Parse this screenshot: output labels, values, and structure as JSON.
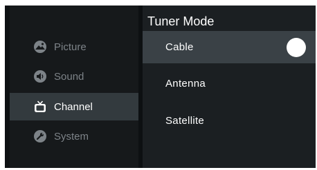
{
  "menu": {
    "items": [
      {
        "label": "Picture",
        "icon": "picture-icon"
      },
      {
        "label": "Sound",
        "icon": "sound-icon"
      },
      {
        "label": "Channel",
        "icon": "channel-icon",
        "selected": true
      },
      {
        "label": "System",
        "icon": "system-icon"
      }
    ]
  },
  "tuner": {
    "title": "Tuner Mode",
    "options": [
      {
        "label": "Cable",
        "selected": true
      },
      {
        "label": "Antenna"
      },
      {
        "label": "Satellite"
      }
    ]
  },
  "colors": {
    "background": "#0d1012",
    "sidebar": "#16191b",
    "sidebar_selected": "#333a3e",
    "panel": "#1b1f22",
    "option_selected": "#3a4146",
    "text_active": "#ffffff",
    "text_inactive": "#7d8388"
  }
}
